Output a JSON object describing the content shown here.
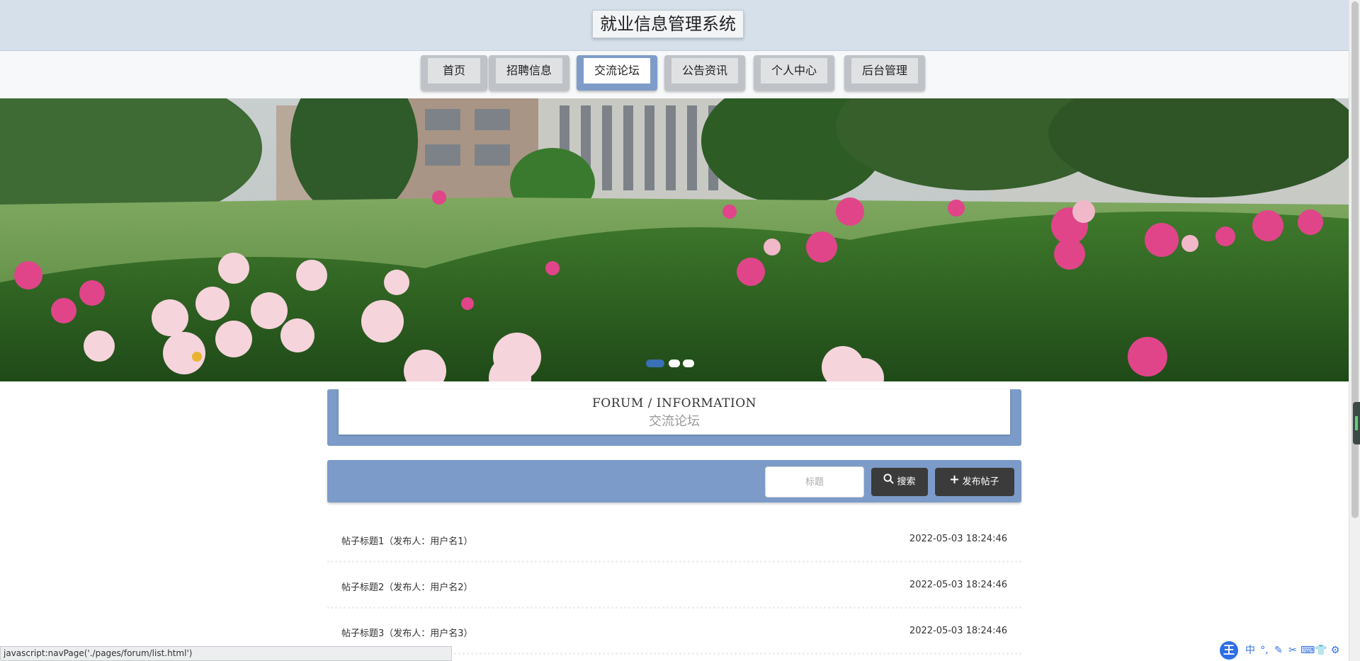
{
  "header": {
    "title": "就业信息管理系统"
  },
  "nav": {
    "items": [
      {
        "label": "首页"
      },
      {
        "label": "招聘信息"
      },
      {
        "label": "交流论坛"
      },
      {
        "label": "公告资讯"
      },
      {
        "label": "个人中心"
      },
      {
        "label": "后台管理"
      }
    ],
    "active": "交流论坛"
  },
  "banner": {
    "slide_count": 3,
    "active_slide": 1
  },
  "forum": {
    "title_en": "FORUM / INFORMATION",
    "title_cn": "交流论坛"
  },
  "search": {
    "placeholder": "标题",
    "search_label": "搜索",
    "post_label": "发布帖子"
  },
  "posts": [
    {
      "title": "帖子标题1（发布人：用户名1）",
      "time": "2022-05-03 18:24:46"
    },
    {
      "title": "帖子标题2（发布人：用户名2）",
      "time": "2022-05-03 18:24:46"
    },
    {
      "title": "帖子标题3（发布人：用户名3）",
      "time": "2022-05-03 18:24:46"
    }
  ],
  "status_bar": {
    "text": "javascript:navPage('./pages/forum/list.html')"
  },
  "ime": {
    "logo": "王",
    "icons": [
      "中",
      "°,",
      "✎",
      "✂",
      "⌨",
      "👕",
      "⚙"
    ]
  },
  "colors": {
    "accent": "#7c9bc8",
    "header_bg": "#d6e0ea",
    "button_dark": "#3b3b3b",
    "dot_active": "#3b6fb6"
  }
}
